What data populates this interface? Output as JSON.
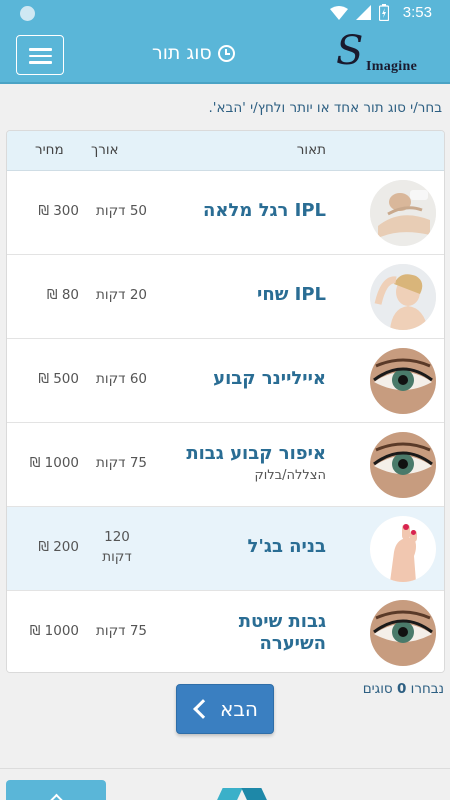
{
  "status_bar": {
    "time": "3:53"
  },
  "app_bar": {
    "title": "סוג תור",
    "logo_text": "Imagine",
    "logo_letter": "S"
  },
  "instruction": "בחר/י סוג תור אחד או יותר ולחץ/י 'הבא'.",
  "table": {
    "headers": {
      "description": "תאור",
      "length": "אורך",
      "price": "מחיר"
    },
    "rows": [
      {
        "name": "IPL רגל מלאה",
        "sub": "",
        "length": "50 דקות",
        "price": "300 ₪",
        "image": "leg-treatment"
      },
      {
        "name": "IPL שחי",
        "sub": "",
        "length": "20 דקות",
        "price": "80 ₪",
        "image": "underarm-treatment"
      },
      {
        "name": "אייליינר קבוע",
        "sub": "",
        "length": "60 דקות",
        "price": "500 ₪",
        "image": "eye"
      },
      {
        "name": "איפור קבוע גבות",
        "sub": "הצללה/בלוק",
        "length": "75 דקות",
        "price": "1000 ₪",
        "image": "eye"
      },
      {
        "name": "בניה בג'ל",
        "sub": "",
        "length_num": "120",
        "length_unit": "דקות",
        "price": "200 ₪",
        "image": "nails"
      },
      {
        "name": "גבות שיטת",
        "name_line2": "השיערה",
        "length": "75 דקות",
        "price": "1000 ₪",
        "image": "eye"
      }
    ]
  },
  "selection": {
    "prefix": "נבחרו",
    "count": "0",
    "suffix": "סוגים"
  },
  "next_button": {
    "label": "הבא"
  },
  "colors": {
    "primary": "#5ab6d8",
    "button": "#3a7fc1",
    "title_text": "#2a6d94"
  }
}
